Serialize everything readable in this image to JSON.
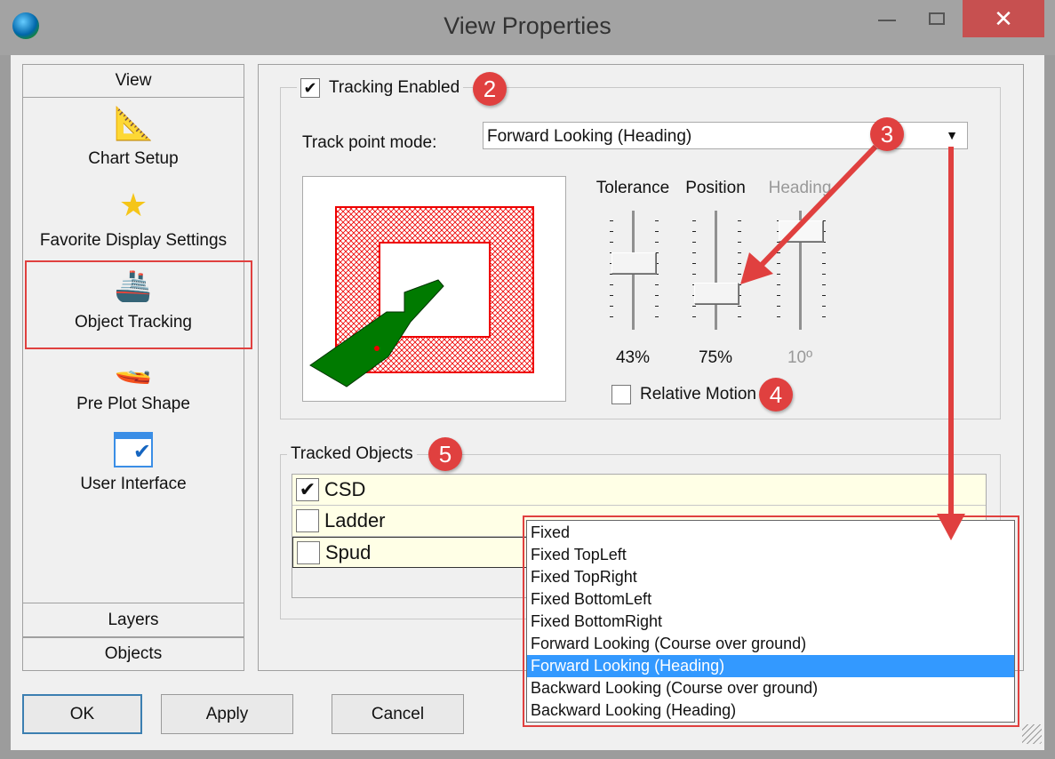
{
  "window": {
    "title": "View Properties",
    "app_icon": "globe-icon"
  },
  "sidebar": {
    "header": "View",
    "items": [
      {
        "label": "Chart Setup",
        "icon": "protractor-pencil-icon"
      },
      {
        "label": "Favorite Display Settings",
        "icon": "star-check-icon"
      },
      {
        "label": "Object Tracking",
        "icon": "boat-eye-icon",
        "selected": true
      },
      {
        "label": "Pre Plot Shape",
        "icon": "boat-shape-icon"
      },
      {
        "label": "User Interface",
        "icon": "window-check-icon"
      }
    ],
    "bottom": [
      "Layers",
      "Objects"
    ]
  },
  "tracking": {
    "enabled_label": "Tracking Enabled",
    "enabled": true,
    "mode_label": "Track point mode:",
    "mode_value": "Forward Looking (Heading)",
    "sliders": [
      {
        "label": "Tolerance",
        "value": "43%",
        "level": 0.43,
        "disabled": false
      },
      {
        "label": "Position",
        "value": "75%",
        "level": 0.75,
        "disabled": false
      },
      {
        "label": "Heading",
        "value": "10º",
        "level": 0.1,
        "disabled": true
      }
    ],
    "relative_motion_label": "Relative Motion",
    "relative_motion": false
  },
  "tracked": {
    "label": "Tracked Objects",
    "items": [
      {
        "name": "CSD",
        "checked": true
      },
      {
        "name": "Ladder",
        "checked": false
      },
      {
        "name": "Spud",
        "checked": false
      }
    ]
  },
  "dropdown": {
    "options": [
      "Fixed",
      "Fixed TopLeft",
      "Fixed TopRight",
      "Fixed BottomLeft",
      "Fixed BottomRight",
      "Forward Looking (Course over ground)",
      "Forward Looking (Heading)",
      "Backward Looking (Course over ground)",
      "Backward Looking (Heading)"
    ],
    "selected": "Forward Looking (Heading)"
  },
  "buttons": {
    "ok": "OK",
    "apply": "Apply",
    "cancel": "Cancel"
  },
  "badges": [
    "2",
    "3",
    "4",
    "5"
  ],
  "colors": {
    "annotation": "#e0403f",
    "selection": "#3399ff",
    "boat": "#007a00",
    "zone": "#e00000"
  }
}
